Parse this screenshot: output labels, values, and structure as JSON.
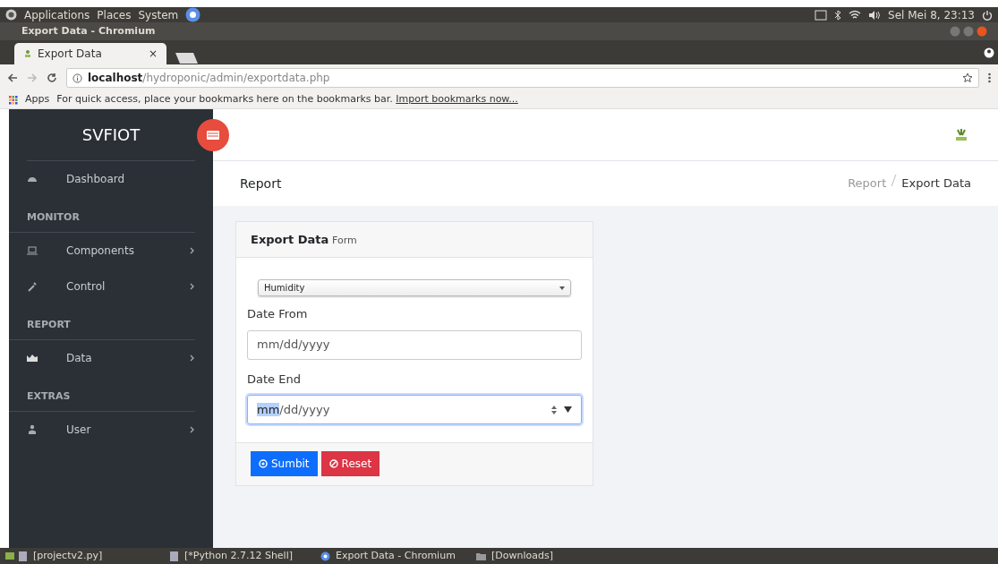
{
  "top_panel": {
    "menus": [
      "Applications",
      "Places",
      "System"
    ],
    "clock": "Sel Mei  8, 23:13"
  },
  "window": {
    "title": "Export Data - Chromium"
  },
  "tabs": [
    {
      "label": "Export Data",
      "selected": true,
      "close": "×"
    }
  ],
  "address_bar": {
    "host": "localhost",
    "path": "/hydroponic/admin/exportdata.php"
  },
  "bookmarks_bar": {
    "apps": "Apps",
    "hint": "For quick access, place your bookmarks here on the bookmarks bar.",
    "link": "Import bookmarks now..."
  },
  "sidebar": {
    "brand": "SVFIOT",
    "items": [
      {
        "kind": "link",
        "label": "Dashboard",
        "submenu": false
      },
      {
        "kind": "section",
        "label": "MONITOR"
      },
      {
        "kind": "link",
        "label": "Components",
        "submenu": true
      },
      {
        "kind": "link",
        "label": "Control",
        "submenu": true
      },
      {
        "kind": "section",
        "label": "REPORT"
      },
      {
        "kind": "link",
        "label": "Data",
        "submenu": true
      },
      {
        "kind": "section",
        "label": "EXTRAS"
      },
      {
        "kind": "link",
        "label": "User",
        "submenu": true
      }
    ]
  },
  "page_header": {
    "title": "Report",
    "breadcrumb": [
      {
        "label": "Report",
        "selected": false
      },
      {
        "label": "Export Data",
        "selected": true
      }
    ]
  },
  "form": {
    "title": "Export Data",
    "subtitle": "Form",
    "sensor": "Humidity",
    "fields": [
      {
        "label": "Date From",
        "focused": false,
        "segments": [
          {
            "text": "mm/dd/yyyy",
            "selected": false
          }
        ]
      },
      {
        "label": "Date End",
        "focused": true,
        "segments": [
          {
            "text": "mm",
            "selected": true
          },
          {
            "text": "/dd/yyyy",
            "selected": false
          }
        ]
      }
    ],
    "buttons": [
      {
        "kind": "primary",
        "label": "Sumbit"
      },
      {
        "kind": "danger",
        "label": "Reset"
      }
    ]
  },
  "taskbar": [
    {
      "label": "[projectv2.py]"
    },
    {
      "label": "[*Python 2.7.12 Shell]"
    },
    {
      "label": "Export Data - Chromium"
    },
    {
      "label": "[Downloads]"
    }
  ]
}
